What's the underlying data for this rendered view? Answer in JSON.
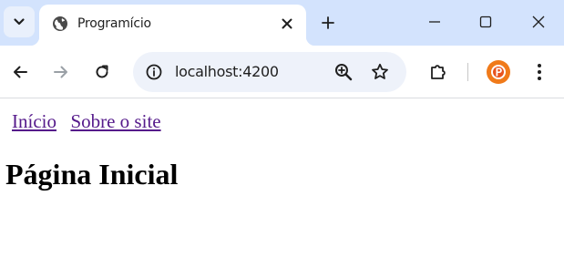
{
  "browser": {
    "tab": {
      "title": "Programício",
      "favicon": "globe-icon"
    },
    "address_bar": {
      "url": "localhost:4200"
    },
    "colors": {
      "tabstrip": "#d3e3fd",
      "omnibox": "#eef2fa",
      "profile": "#f07a1a",
      "link": "#551a8b"
    },
    "icons": {
      "tab_search": "chevron-down-icon",
      "new_tab": "plus-icon",
      "minimize": "minimize-icon",
      "maximize": "maximize-icon",
      "close": "close-icon",
      "back": "back-arrow-icon",
      "forward": "forward-arrow-icon",
      "reload": "reload-icon",
      "site_info": "site-info-icon",
      "zoom": "zoom-in-icon",
      "bookmark": "star-icon",
      "extensions": "puzzle-icon",
      "menu": "kebab-menu-icon"
    }
  },
  "page": {
    "nav": [
      {
        "label": "Início"
      },
      {
        "label": "Sobre o site"
      }
    ],
    "heading": "Página Inicial"
  }
}
